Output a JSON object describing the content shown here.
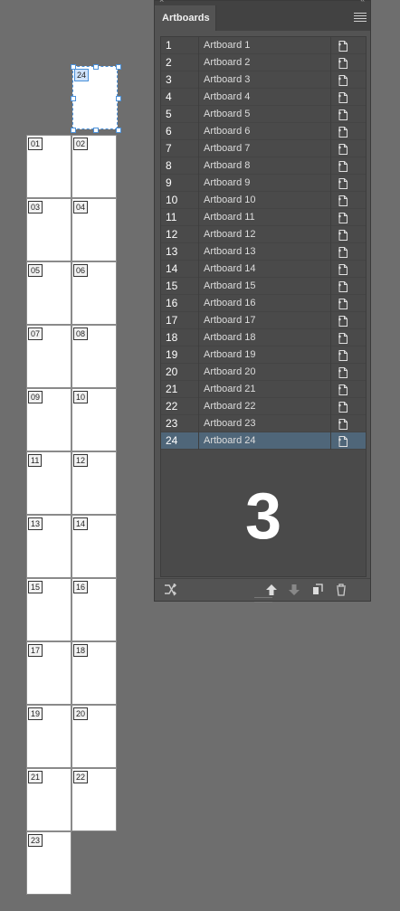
{
  "panel": {
    "tab_label": "Artboards",
    "big_label": "3",
    "rows": [
      {
        "num": "1",
        "name": "Artboard 1"
      },
      {
        "num": "2",
        "name": "Artboard 2"
      },
      {
        "num": "3",
        "name": "Artboard 3"
      },
      {
        "num": "4",
        "name": "Artboard 4"
      },
      {
        "num": "5",
        "name": "Artboard 5"
      },
      {
        "num": "6",
        "name": "Artboard 6"
      },
      {
        "num": "7",
        "name": "Artboard 7"
      },
      {
        "num": "8",
        "name": "Artboard 8"
      },
      {
        "num": "9",
        "name": "Artboard 9"
      },
      {
        "num": "10",
        "name": "Artboard 10"
      },
      {
        "num": "11",
        "name": "Artboard 11"
      },
      {
        "num": "12",
        "name": "Artboard 12"
      },
      {
        "num": "13",
        "name": "Artboard 13"
      },
      {
        "num": "14",
        "name": "Artboard 14"
      },
      {
        "num": "15",
        "name": "Artboard 15"
      },
      {
        "num": "16",
        "name": "Artboard 16"
      },
      {
        "num": "17",
        "name": "Artboard 17"
      },
      {
        "num": "18",
        "name": "Artboard 18"
      },
      {
        "num": "19",
        "name": "Artboard 19"
      },
      {
        "num": "20",
        "name": "Artboard 20"
      },
      {
        "num": "21",
        "name": "Artboard 21"
      },
      {
        "num": "22",
        "name": "Artboard 22"
      },
      {
        "num": "23",
        "name": "Artboard 23"
      },
      {
        "num": "24",
        "name": "Artboard 24"
      }
    ],
    "selected_row": "24",
    "footer_icons": [
      "rearrange-icon",
      "move-up-icon",
      "move-down-icon",
      "new-artboard-icon",
      "delete-icon"
    ]
  },
  "canvas": {
    "artboard_labels": [
      "01",
      "02",
      "03",
      "04",
      "05",
      "06",
      "07",
      "08",
      "09",
      "10",
      "11",
      "12",
      "13",
      "14",
      "15",
      "16",
      "17",
      "18",
      "19",
      "20",
      "21",
      "22",
      "23",
      "24"
    ],
    "selected_artboard": "24"
  },
  "colors": {
    "canvas_bg": "#6e6e6e",
    "panel_bg": "#535353",
    "selection_blue": "#4a90d9",
    "row_selected": "#4f6679"
  }
}
